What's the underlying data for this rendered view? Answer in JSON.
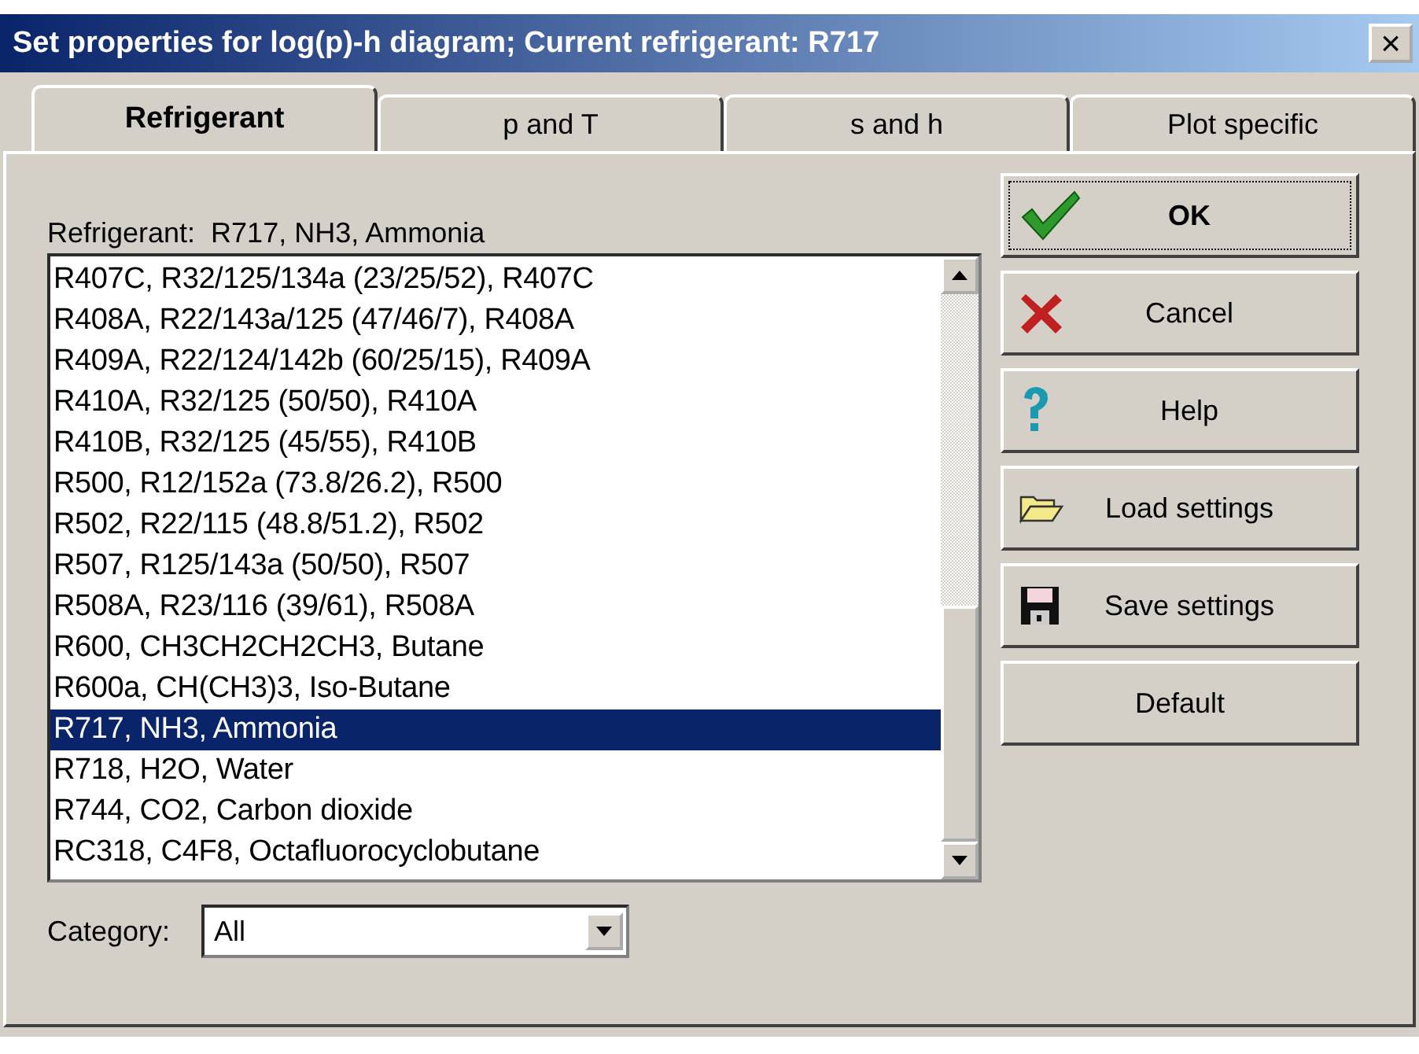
{
  "window": {
    "title": "Set properties for log(p)-h diagram; Current refrigerant: R717",
    "close": "×"
  },
  "tabs": [
    {
      "label": "Refrigerant",
      "selected": true
    },
    {
      "label": "p and T",
      "selected": false
    },
    {
      "label": "s and h",
      "selected": false
    },
    {
      "label": "Plot specific",
      "selected": false
    }
  ],
  "refrigerant_label": "Refrigerant:  R717, NH3, Ammonia",
  "list": [
    {
      "text": "R407C, R32/125/134a (23/25/52), R407C",
      "selected": false
    },
    {
      "text": "R408A, R22/143a/125 (47/46/7), R408A",
      "selected": false
    },
    {
      "text": "R409A, R22/124/142b (60/25/15), R409A",
      "selected": false
    },
    {
      "text": "R410A, R32/125 (50/50), R410A",
      "selected": false
    },
    {
      "text": "R410B, R32/125 (45/55), R410B",
      "selected": false
    },
    {
      "text": "R500, R12/152a (73.8/26.2), R500",
      "selected": false
    },
    {
      "text": "R502, R22/115 (48.8/51.2), R502",
      "selected": false
    },
    {
      "text": "R507, R125/143a (50/50), R507",
      "selected": false
    },
    {
      "text": "R508A, R23/116 (39/61), R508A",
      "selected": false
    },
    {
      "text": "R600, CH3CH2CH2CH3, Butane",
      "selected": false
    },
    {
      "text": "R600a, CH(CH3)3, Iso-Butane",
      "selected": false
    },
    {
      "text": "R717, NH3, Ammonia",
      "selected": true
    },
    {
      "text": "R718, H2O, Water",
      "selected": false
    },
    {
      "text": "R744, CO2, Carbon dioxide",
      "selected": false
    },
    {
      "text": "RC318, C4F8, Octafluorocyclobutane",
      "selected": false
    }
  ],
  "category": {
    "label": "Category:",
    "value": "All"
  },
  "buttons": [
    {
      "kind": "ok",
      "label": "OK"
    },
    {
      "kind": "cancel",
      "label": "Cancel"
    },
    {
      "kind": "help",
      "label": "Help"
    },
    {
      "kind": "load",
      "label": "Load settings"
    },
    {
      "kind": "save",
      "label": "Save settings"
    },
    {
      "kind": "default",
      "label": "Default"
    }
  ]
}
